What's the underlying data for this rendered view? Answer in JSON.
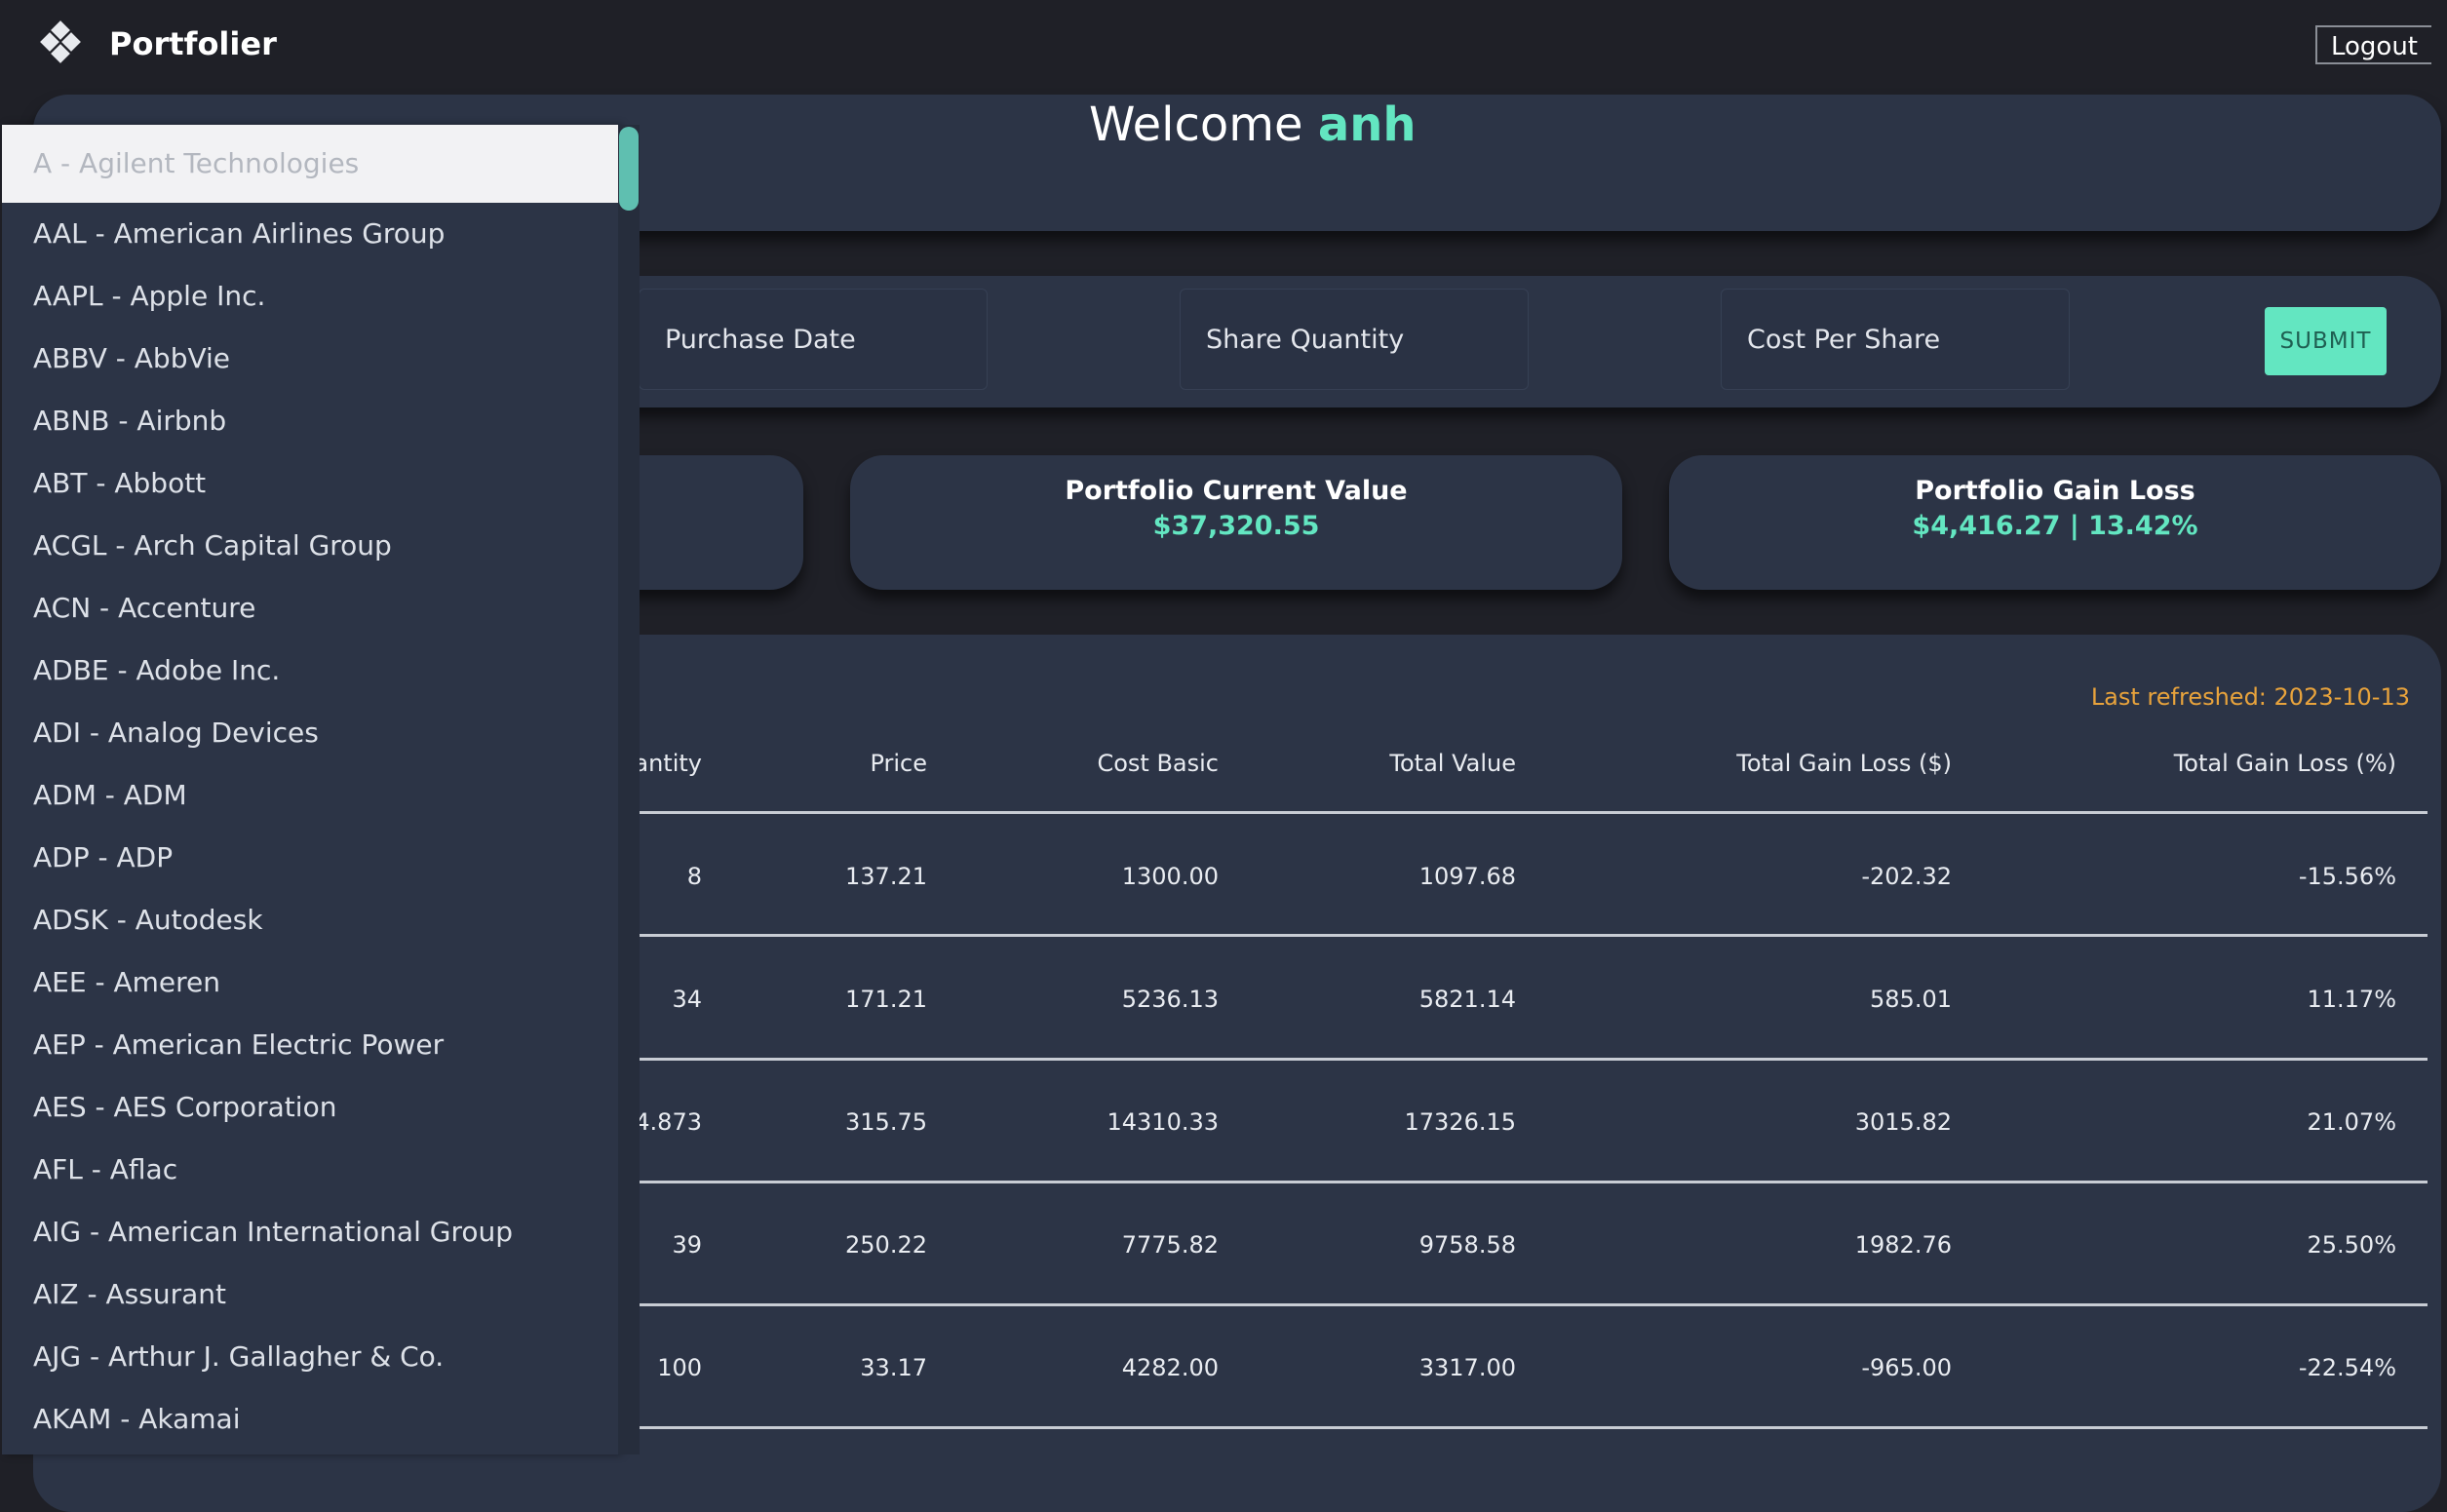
{
  "app": {
    "title": "Portfolier",
    "logo_icon": "diamond-cluster-logo-icon"
  },
  "header": {
    "logout_label": "Logout"
  },
  "welcome": {
    "greeting": "Welcome",
    "username": "anh"
  },
  "form": {
    "purchase_date_placeholder": "Purchase Date",
    "share_quantity_placeholder": "Share Quantity",
    "cost_per_share_placeholder": "Cost Per Share",
    "submit_label": "SUBMIT"
  },
  "stats": {
    "current_value_title": "Portfolio Current Value",
    "current_value": "$37,320.55",
    "gain_loss_title": "Portfolio Gain Loss",
    "gain_loss_value": "$4,416.27 | 13.42%"
  },
  "table": {
    "last_refreshed": "Last refreshed: 2023-10-13",
    "columns": [
      "antity",
      "Price",
      "Cost Basic",
      "Total Value",
      "Total Gain Loss ($)",
      "Total Gain Loss (%)"
    ],
    "rows": [
      [
        "8",
        "137.21",
        "1300.00",
        "1097.68",
        "-202.32",
        "-15.56%"
      ],
      [
        "34",
        "171.21",
        "5236.13",
        "5821.14",
        "585.01",
        "11.17%"
      ],
      [
        "4.873",
        "315.75",
        "14310.33",
        "17326.15",
        "3015.82",
        "21.07%"
      ],
      [
        "39",
        "250.22",
        "7775.82",
        "9758.58",
        "1982.76",
        "25.50%"
      ],
      [
        "100",
        "33.17",
        "4282.00",
        "3317.00",
        "-965.00",
        "-22.54%"
      ]
    ]
  },
  "dropdown": {
    "selected_index": 0,
    "options": [
      "A - Agilent Technologies",
      "AAL - American Airlines Group",
      "AAPL - Apple Inc.",
      "ABBV - AbbVie",
      "ABNB - Airbnb",
      "ABT - Abbott",
      "ACGL - Arch Capital Group",
      "ACN - Accenture",
      "ADBE - Adobe Inc.",
      "ADI - Analog Devices",
      "ADM - ADM",
      "ADP - ADP",
      "ADSK - Autodesk",
      "AEE - Ameren",
      "AEP - American Electric Power",
      "AES - AES Corporation",
      "AFL - Aflac",
      "AIG - American International Group",
      "AIZ - Assurant",
      "AJG - Arthur J. Gallagher & Co.",
      "AKAM - Akamai"
    ]
  },
  "colors": {
    "background": "#1f2027",
    "card": "#2c3446",
    "accent": "#63e6c1",
    "refreshed_text": "#e8a33c"
  }
}
